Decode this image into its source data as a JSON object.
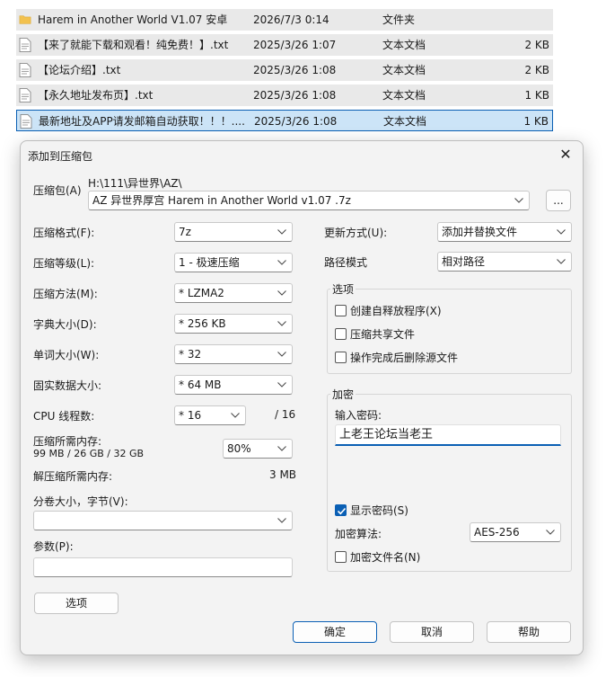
{
  "files": [
    {
      "name": "Harem in Another World V1.07 安卓",
      "date": "2026/7/3 0:14",
      "type": "文件夹",
      "size": "",
      "icon": "folder-icon",
      "selected": false
    },
    {
      "name": "【来了就能下载和观看！纯免费！】.txt",
      "date": "2025/3/26 1:07",
      "type": "文本文档",
      "size": "2 KB",
      "icon": "text-file-icon",
      "selected": false
    },
    {
      "name": "【论坛介绍】.txt",
      "date": "2025/3/26 1:08",
      "type": "文本文档",
      "size": "2 KB",
      "icon": "text-file-icon",
      "selected": false
    },
    {
      "name": "【永久地址发布页】.txt",
      "date": "2025/3/26 1:08",
      "type": "文本文档",
      "size": "1 KB",
      "icon": "text-file-icon",
      "selected": false
    },
    {
      "name": "最新地址及APP请发邮箱自动获取！！！....",
      "date": "2025/3/26 1:08",
      "type": "文本文档",
      "size": "1 KB",
      "icon": "text-file-icon",
      "selected": true
    }
  ],
  "dialog": {
    "title": "添加到压缩包",
    "close": "✕",
    "archive": {
      "label": "压缩包(A)",
      "path": "H:\\111\\异世界\\AZ\\",
      "value": "AZ 异世界厚宫 Harem in Another World v1.07 .7z",
      "browse": "..."
    },
    "left": {
      "format_label": "压缩格式(F):",
      "format_value": "7z",
      "level_label": "压缩等级(L):",
      "level_value": "1 - 极速压缩",
      "method_label": "压缩方法(M):",
      "method_value": "*  LZMA2",
      "dict_label": "字典大小(D):",
      "dict_value": "*  256 KB",
      "word_label": "单词大小(W):",
      "word_value": "*  32",
      "solid_label": "固实数据大小:",
      "solid_value": "*  64 MB",
      "cpu_label": "CPU 线程数:",
      "cpu_value": "*  16",
      "cpu_total": "/ 16",
      "mem_label": "压缩所需内存:",
      "mem_detail": "99 MB / 26 GB / 32 GB",
      "mem_value": "80%",
      "demem_label": "解压缩所需内存:",
      "demem_value": "3 MB",
      "split_label": "分卷大小，字节(V):",
      "split_value": "",
      "params_label": "参数(P):",
      "params_value": "",
      "options_button": "选项"
    },
    "right": {
      "update_label": "更新方式(U):",
      "update_value": "添加并替换文件",
      "path_label": "路径模式",
      "path_value": "相对路径",
      "options_title": "选项",
      "opt_sfx": "创建自释放程序(X)",
      "opt_shared": "压缩共享文件",
      "opt_delete": "操作完成后删除源文件",
      "enc_title": "加密",
      "pw_label": "输入密码:",
      "pw_value": "上老王论坛当老王",
      "show_pw": "显示密码(S)",
      "enc_method_label": "加密算法:",
      "enc_method_value": "AES-256",
      "enc_names": "加密文件名(N)"
    },
    "buttons": {
      "ok": "确定",
      "cancel": "取消",
      "help": "帮助"
    }
  },
  "colors": {
    "accent": "#0a5fb4",
    "selection": "#cce4f7",
    "row": "#e9e9e9",
    "folder": "#f2c14e"
  }
}
